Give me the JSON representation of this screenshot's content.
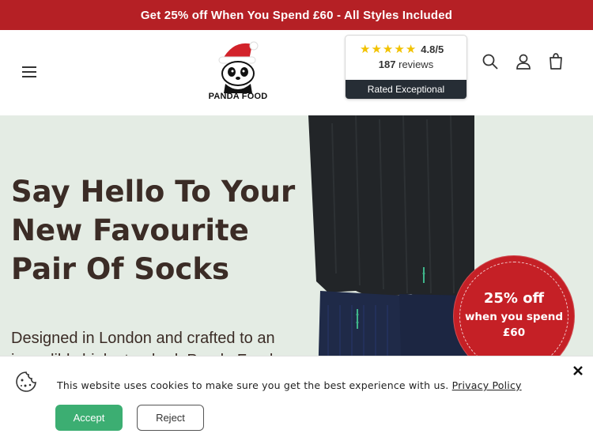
{
  "announcement": {
    "text": "Get 25% off When You Spend £60 - All Styles Included"
  },
  "header": {
    "logo_text": "PANDA FOOD",
    "reviews": {
      "score": "4.8/5",
      "count": "187",
      "count_suffix": "reviews",
      "rating_label": "Rated Exceptional",
      "stars": 5
    },
    "icons": [
      "menu-icon",
      "search-icon",
      "account-icon",
      "cart-icon"
    ]
  },
  "hero": {
    "title_lines": [
      "Say Hello To Your",
      "New Favourite",
      "Pair Of Socks"
    ],
    "description": "Designed in London and crafted to an incredibly high standard. Panda Food",
    "promo": {
      "line1": "25% off",
      "line2": "when you spend",
      "line3": "£60"
    }
  },
  "cookie_banner": {
    "message": "This website uses cookies to make sure you get the best experience with us.",
    "policy_link": "Privacy Policy",
    "accept_label": "Accept",
    "reject_label": "Reject"
  },
  "colors": {
    "announcement_bg": "#b52025",
    "hero_bg": "#e4ece4",
    "promo_bg": "#c52026",
    "accept_bg": "#3cae72",
    "heading": "#3b2c26"
  }
}
